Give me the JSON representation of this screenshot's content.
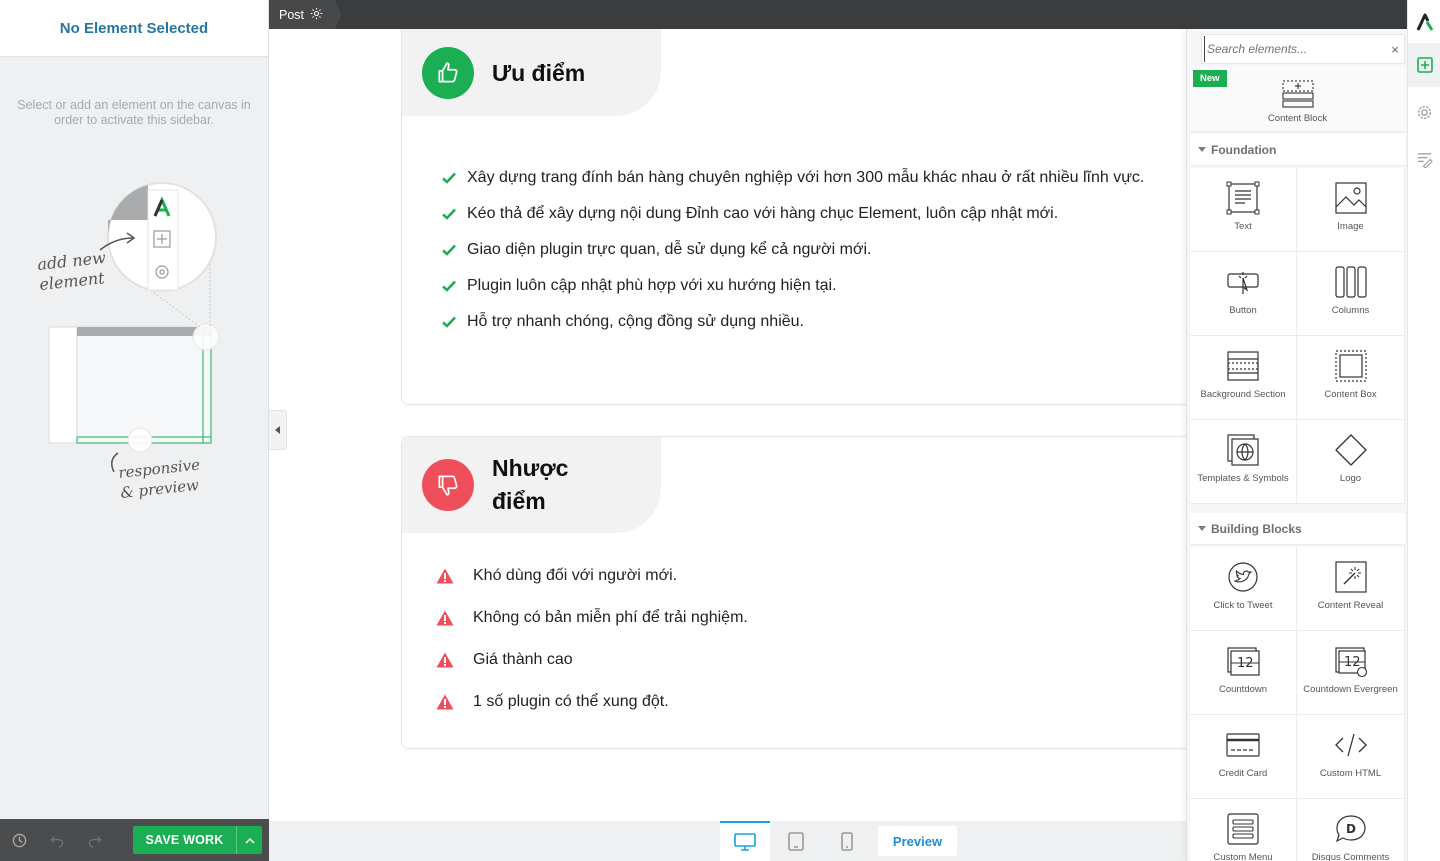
{
  "left_sidebar": {
    "title": "No Element Selected",
    "hint": "Select or add an element on the canvas in order to activate this sidebar.",
    "illustration_text": {
      "add": "add new element",
      "responsive": "responsive & preview"
    },
    "save_label": "SAVE WORK"
  },
  "topbar": {
    "post_label": "Post"
  },
  "pros": {
    "title": "Ưu điểm",
    "items": [
      "Xây dựng trang đính bán hàng chuyên nghiệp với hơn 300 mẫu khác nhau ở rất nhiều lĩnh vực.",
      "Kéo thả để xây dựng nội dung Đỉnh cao với hàng chục Element, luôn cập nhật mới.",
      "Giao diện plugin trực quan, dễ sử dụng kể cả người mới.",
      "Plugin luôn cập nhật phù hợp với xu hướng hiện tại.",
      "Hỗ trợ nhanh chóng, cộng đồng sử dụng nhiều."
    ],
    "color": "#1bae53"
  },
  "cons": {
    "title_line1": "Nhược",
    "title_line2": "điểm",
    "items": [
      "Khó dùng đối với người mới.",
      "Không có bản miễn phí để trải nghiệm.",
      "Giá thành cao",
      "1 số plugin có thể xung đột."
    ],
    "color": "#ef4f5a"
  },
  "responsive": {
    "preview_label": "Preview"
  },
  "elements_panel": {
    "search_placeholder": "Search elements...",
    "new_tag": "New",
    "content_block": "Content Block",
    "foundation": {
      "title": "Foundation",
      "items": [
        "Text",
        "Image",
        "Button",
        "Columns",
        "Background Section",
        "Content Box",
        "Templates & Symbols",
        "Logo"
      ]
    },
    "building_blocks": {
      "title": "Building Blocks",
      "items": [
        "Click to Tweet",
        "Content Reveal",
        "Countdown",
        "Countdown Evergreen",
        "Credit Card",
        "Custom HTML",
        "Custom Menu",
        "Disqus Comments"
      ]
    }
  },
  "colors": {
    "accent_green": "#1bae53",
    "accent_blue": "#2477a5",
    "danger_red": "#ef4f5a"
  }
}
